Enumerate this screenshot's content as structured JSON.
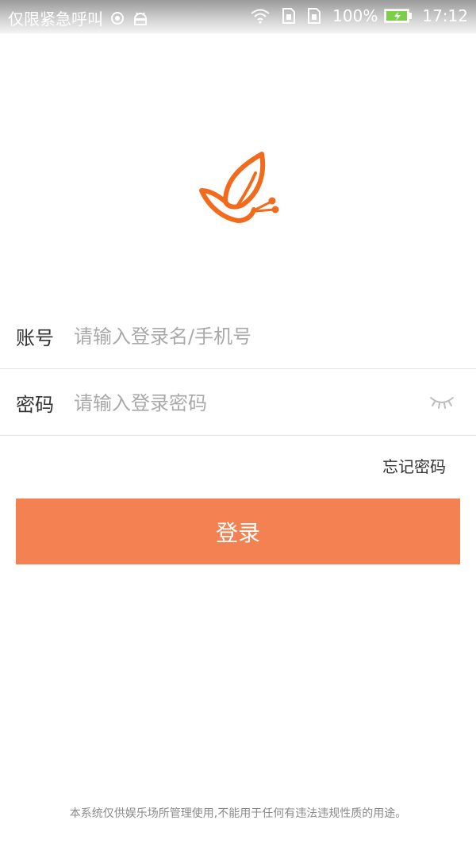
{
  "status_bar": {
    "carrier": "仅限紧急呼叫",
    "battery_percent": "100%",
    "time": "17:12",
    "icons": [
      "location-icon",
      "android-debug-icon",
      "wifi-icon",
      "sim-card-icon",
      "sim-card-2-icon",
      "battery-charging-icon"
    ]
  },
  "logo": {
    "icon": "butterfly-logo-icon",
    "color": "#f26a1b"
  },
  "form": {
    "account": {
      "label": "账号",
      "placeholder": "请输入登录名/手机号",
      "value": ""
    },
    "password": {
      "label": "密码",
      "placeholder": "请输入登录密码",
      "value": "",
      "toggle_icon": "eye-closed-icon"
    },
    "forgot_label": "忘记密码",
    "login_label": "登录"
  },
  "footer": {
    "notice": "本系统仅供娱乐场所管理使用,不能用于任何有违法违规性质的用途。"
  },
  "colors": {
    "accent": "#f38152",
    "text": "#333333",
    "placeholder": "#a9a9a9",
    "divider": "#e3e3e3"
  }
}
